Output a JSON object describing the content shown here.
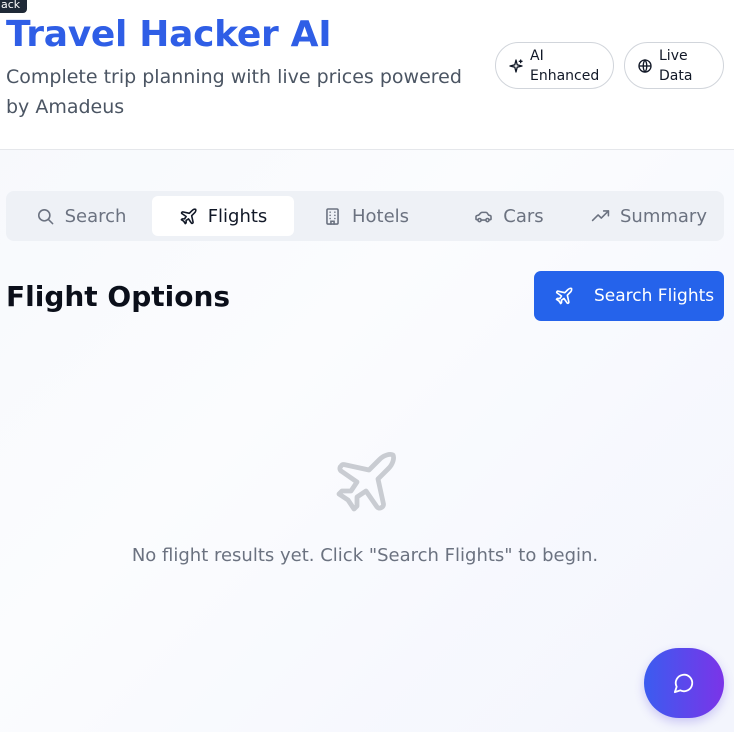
{
  "tooltip": {
    "text": "ack"
  },
  "header": {
    "title": "Travel Hacker AI",
    "subtitle": "Complete trip planning with live prices powered by Amadeus",
    "badges": [
      {
        "label": "AI Enhanced",
        "icon": "sparkle-icon"
      },
      {
        "label": "Live Data",
        "icon": "globe-icon"
      }
    ]
  },
  "tabs": [
    {
      "label": "Search",
      "icon": "search-icon",
      "active": false
    },
    {
      "label": "Flights",
      "icon": "plane-icon",
      "active": true
    },
    {
      "label": "Hotels",
      "icon": "building-icon",
      "active": false
    },
    {
      "label": "Cars",
      "icon": "car-icon",
      "active": false
    },
    {
      "label": "Summary",
      "icon": "trending-up-icon",
      "active": false
    }
  ],
  "main": {
    "title": "Flight Options",
    "search_button": "Search Flights",
    "empty_message": "No flight results yet. Click \"Search Flights\" to begin."
  },
  "colors": {
    "brand": "#2f5ee6",
    "button": "#2563eb",
    "fab_gradient": [
      "#3b5cf0",
      "#7b34e8"
    ]
  }
}
